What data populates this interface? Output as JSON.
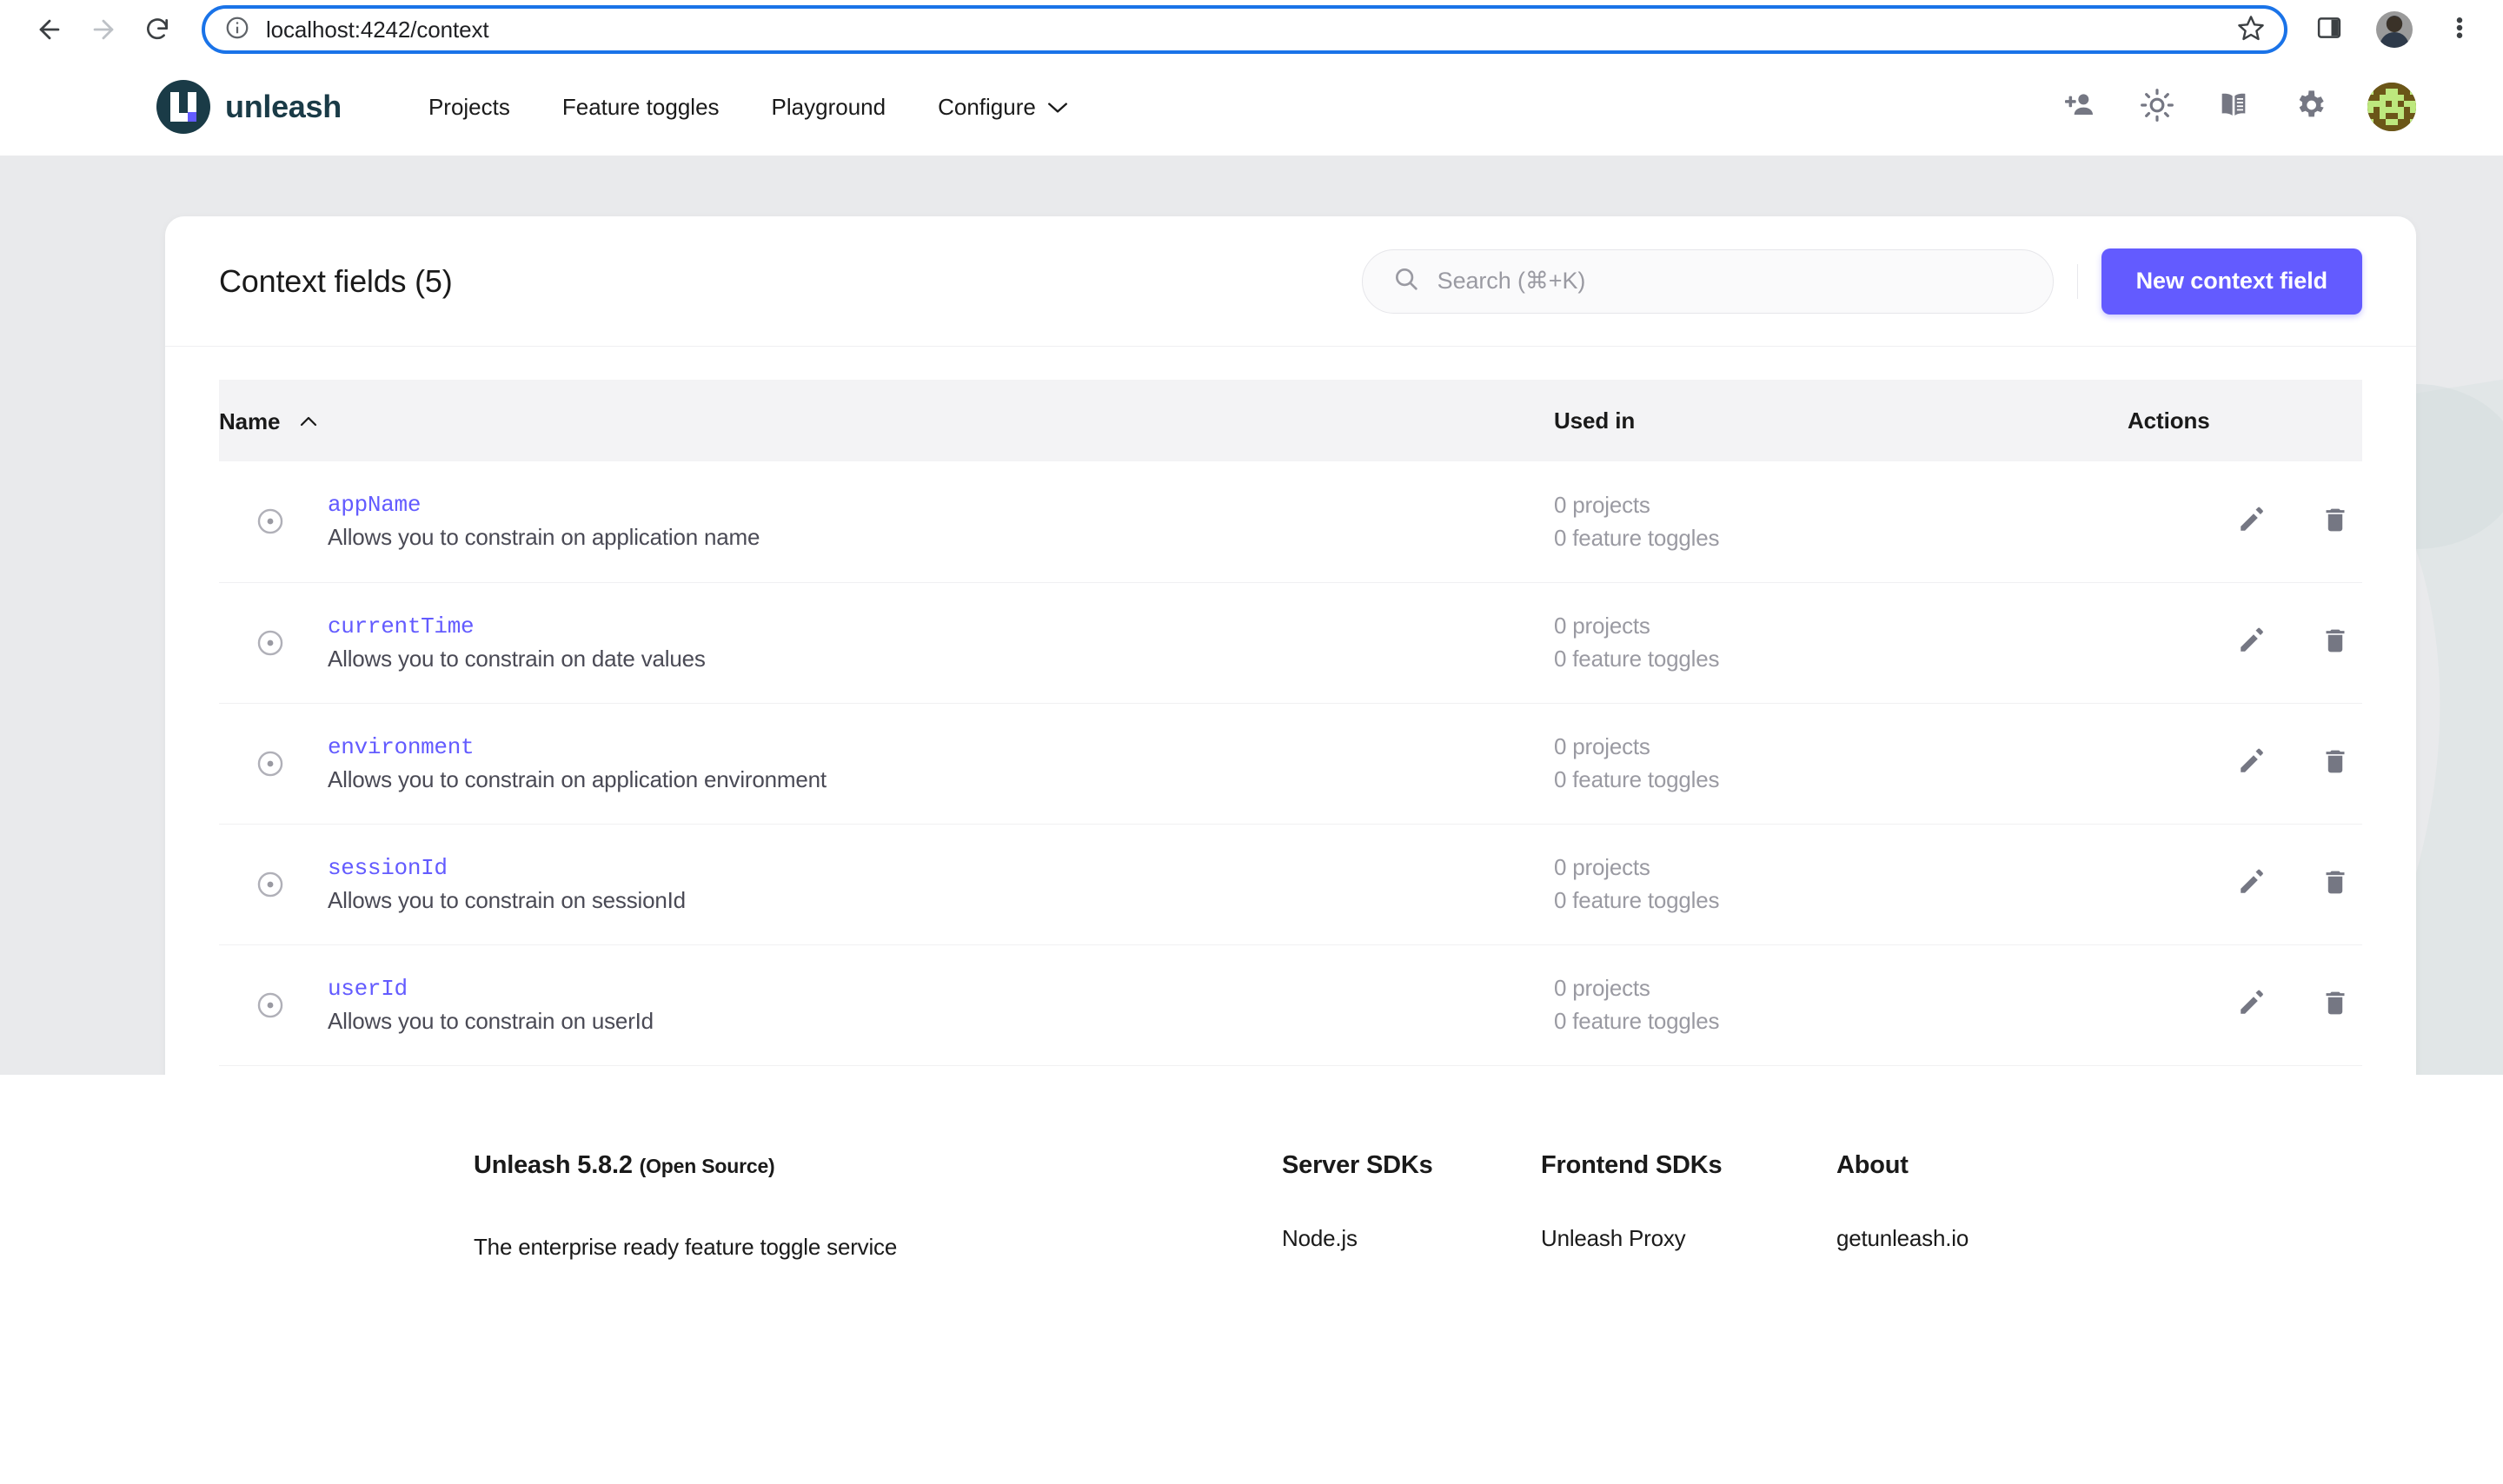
{
  "browser": {
    "url": "localhost:4242/context",
    "back_icon": "back-arrow-icon",
    "forward_icon": "forward-arrow-icon",
    "reload_icon": "reload-icon",
    "site_info_icon": "site-info-icon",
    "bookmark_icon": "star-icon",
    "sidepanel_icon": "side-panel-icon",
    "menu_icon": "three-dot-menu-icon"
  },
  "header": {
    "brand": "unleash",
    "nav": [
      {
        "label": "Projects"
      },
      {
        "label": "Feature toggles"
      },
      {
        "label": "Playground"
      },
      {
        "label": "Configure",
        "caret": "∨"
      }
    ],
    "icons": [
      {
        "name": "add-user-icon"
      },
      {
        "name": "theme-sun-icon"
      },
      {
        "name": "documentation-book-icon"
      },
      {
        "name": "settings-gear-icon"
      }
    ],
    "avatar_alt": "user-avatar"
  },
  "page": {
    "title": "Context fields (5)",
    "search_placeholder": "Search (⌘+K)",
    "search_value": "",
    "new_button": "New context field"
  },
  "table": {
    "columns": {
      "name": "Name",
      "sort_caret": "∧",
      "used_in": "Used in",
      "actions": "Actions"
    },
    "rows": [
      {
        "name": "appName",
        "description": "Allows you to constrain on application name",
        "projects": "0 projects",
        "toggles": "0 feature toggles"
      },
      {
        "name": "currentTime",
        "description": "Allows you to constrain on date values",
        "projects": "0 projects",
        "toggles": "0 feature toggles"
      },
      {
        "name": "environment",
        "description": "Allows you to constrain on application environment",
        "projects": "0 projects",
        "toggles": "0 feature toggles"
      },
      {
        "name": "sessionId",
        "description": "Allows you to constrain on sessionId",
        "projects": "0 projects",
        "toggles": "0 feature toggles"
      },
      {
        "name": "userId",
        "description": "Allows you to constrain on userId",
        "projects": "0 projects",
        "toggles": "0 feature toggles"
      }
    ],
    "row_icon": "target-dot-icon",
    "edit_icon": "edit-pencil-icon",
    "delete_icon": "delete-trash-icon"
  },
  "footer": {
    "brand": "Unleash 5.8.2",
    "brand_suffix": "(Open Source)",
    "tagline": "The enterprise ready feature toggle service",
    "columns": [
      {
        "heading": "Server SDKs",
        "links": [
          "Node.js"
        ]
      },
      {
        "heading": "Frontend SDKs",
        "links": [
          "Unleash Proxy"
        ]
      },
      {
        "heading": "About",
        "links": [
          "getunleash.io"
        ]
      }
    ]
  },
  "colors": {
    "accent": "#635bff",
    "brand_dark": "#1a3b47",
    "page_bg": "#e9eaec",
    "omnibox_focus": "#1a73e8"
  }
}
